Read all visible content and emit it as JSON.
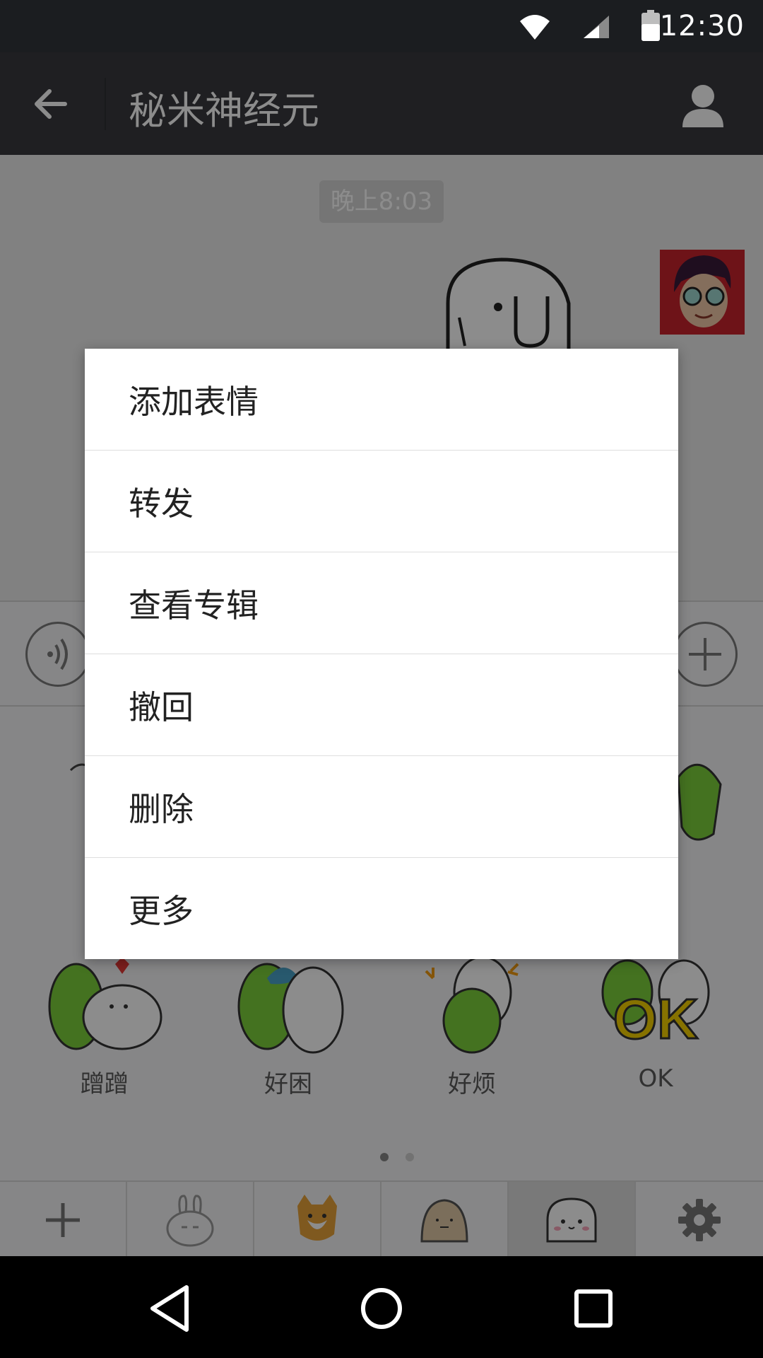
{
  "status_bar": {
    "time": "12:30",
    "icons": [
      "wifi-icon",
      "cell-signal-icon",
      "battery-icon"
    ]
  },
  "action_bar": {
    "title": "秘米神经元",
    "icons": [
      "back-arrow-icon",
      "profile-icon"
    ]
  },
  "chat": {
    "timestamp": "晚上8:03"
  },
  "stickers": [
    {
      "label": "蹭蹭"
    },
    {
      "label": "好困"
    },
    {
      "label": "好烦"
    },
    {
      "label": "OK"
    }
  ],
  "context_menu": {
    "items": [
      {
        "label": "添加表情"
      },
      {
        "label": "转发"
      },
      {
        "label": "查看专辑"
      },
      {
        "label": "撤回"
      },
      {
        "label": "删除"
      },
      {
        "label": "更多"
      }
    ]
  },
  "tab_bar": {
    "tabs": [
      "add-icon",
      "rabbit-sticker-icon",
      "shiba-sticker-icon",
      "blob-sticker-icon",
      "dog-sticker-icon",
      "gear-icon"
    ],
    "active_index": 4
  },
  "pager": {
    "pages": 2,
    "current": 1
  },
  "colors": {
    "header": "#393a3f",
    "status": "#1b1d20",
    "sticker_green": "#7ccf3b",
    "heart_red": "#e53935"
  }
}
